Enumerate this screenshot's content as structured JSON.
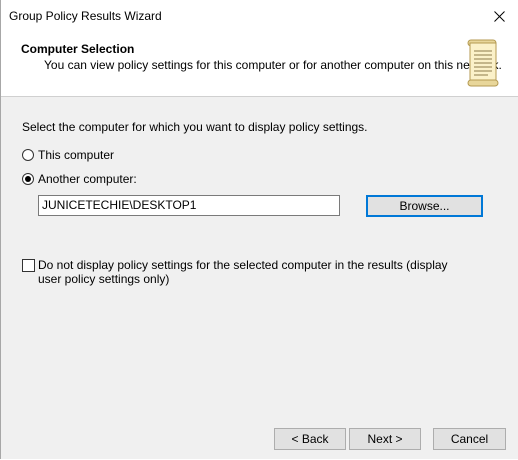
{
  "window": {
    "title": "Group Policy Results Wizard",
    "close_icon": "close-icon"
  },
  "header": {
    "title": "Computer Selection",
    "subtitle": "You can view policy settings for this computer or for another computer on this network.",
    "icon": "scroll-icon"
  },
  "main": {
    "instruction": "Select the computer for which you want to display policy settings.",
    "options": [
      {
        "label": "This computer",
        "selected": false
      },
      {
        "label": "Another computer:",
        "selected": true
      }
    ],
    "computer_name": "JUNICETECHIE\\DESKTOP1",
    "browse_label": "Browse...",
    "checkbox_label": "Do not display policy settings for the selected computer in the results (display user policy settings only)",
    "checkbox_checked": false
  },
  "footer": {
    "back_label": "< Back",
    "next_label": "Next >",
    "cancel_label": "Cancel"
  },
  "colors": {
    "accent": "#0078d7",
    "dialog_bg": "#f0f0f0"
  }
}
